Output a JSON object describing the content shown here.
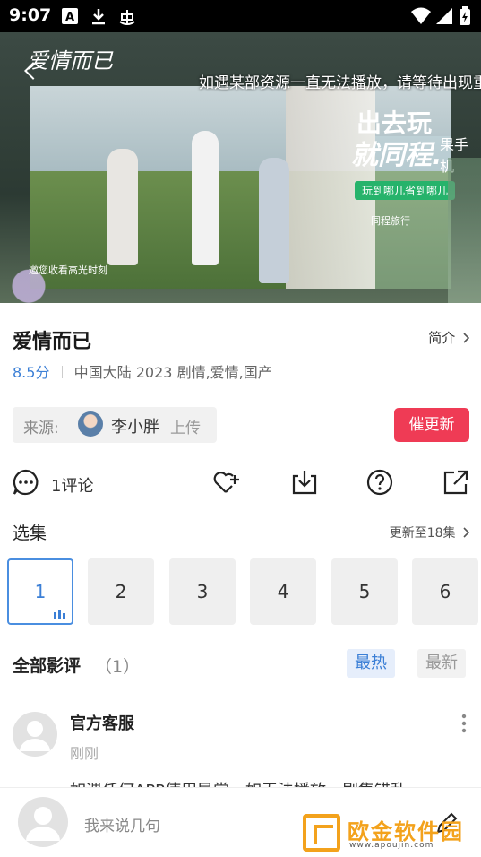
{
  "status_bar": {
    "time": "9:07",
    "icons": [
      "font-a-icon",
      "download-icon",
      "bug-icon"
    ],
    "right_icons": [
      "wifi-icon",
      "signal-icon",
      "battery-icon"
    ]
  },
  "video": {
    "show_logo_text": "爱情而已",
    "caption": "如遇某部资源一直无法播放，请等待出现重启",
    "ad": {
      "line1": "出去玩",
      "line2": "就同程.",
      "side": "果手机",
      "button": "玩到哪儿省到哪儿",
      "logo": "同程旅行"
    },
    "bottom_text": "邀您收看高光时刻"
  },
  "info": {
    "title": "爱情而已",
    "intro_label": "简介",
    "score": "8.5分",
    "region": "中国大陆",
    "year": "2023",
    "genres": "剧情,爱情,国产"
  },
  "source": {
    "label": "来源:",
    "uploader": "李小胖",
    "action": "上传"
  },
  "urge_button": "催更新",
  "actions": {
    "comment_label": "1评论"
  },
  "episodes": {
    "title": "选集",
    "update_text": "更新至18集",
    "items": [
      "1",
      "2",
      "3",
      "4",
      "5",
      "6"
    ],
    "active": "1"
  },
  "reviews": {
    "title": "全部影评",
    "count": "（1）",
    "sort_hot": "最热",
    "sort_new": "最新",
    "items": [
      {
        "name": "官方客服",
        "time": "刚刚",
        "body": "如遇任何APP使用异常，如无法播放，剧集错乱"
      }
    ]
  },
  "bottom": {
    "placeholder": "我来说几句"
  },
  "watermark": {
    "text": "欧金软件园",
    "url": "www.apoujin.com"
  },
  "colors": {
    "accent": "#3b7fd6",
    "urge": "#ef3b55",
    "watermark": "#f3a21c"
  }
}
